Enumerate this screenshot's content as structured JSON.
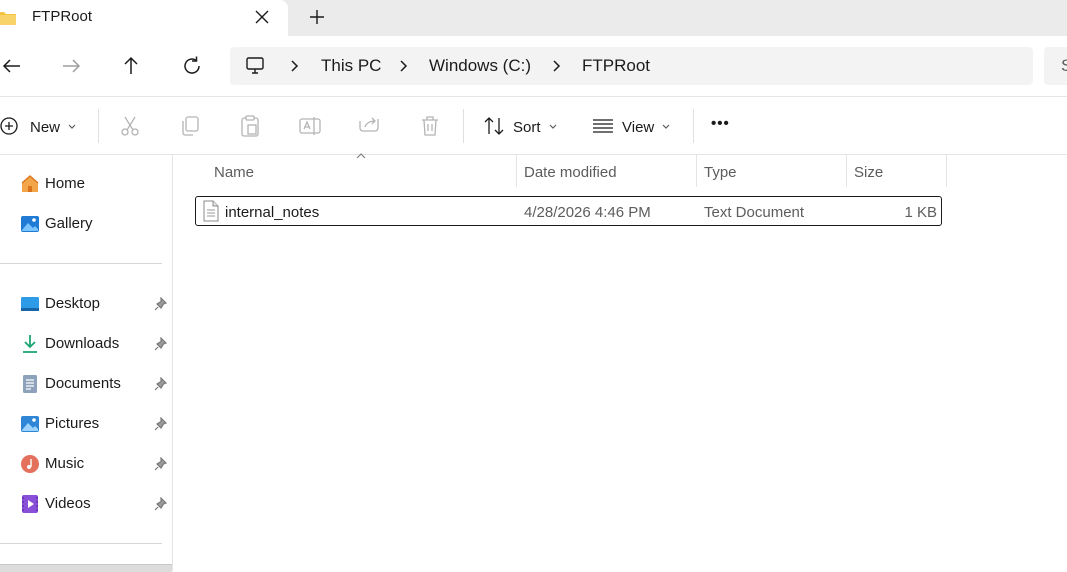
{
  "tab": {
    "title": "FTPRoot",
    "close_icon": "close-icon",
    "new_tab_icon": "plus-icon"
  },
  "nav": {
    "back": "back-arrow-icon",
    "forward": "forward-arrow-icon",
    "up": "up-arrow-icon",
    "refresh": "refresh-icon"
  },
  "breadcrumb": {
    "root_icon": "monitor-icon",
    "items": [
      "This PC",
      "Windows (C:)",
      "FTPRoot"
    ]
  },
  "search": {
    "placeholder": "S"
  },
  "toolbar": {
    "new_label": "New",
    "sort_label": "Sort",
    "view_label": "View",
    "more_label": "•••",
    "icons": [
      "cut-icon",
      "copy-icon",
      "paste-icon",
      "rename-icon",
      "share-icon",
      "delete-icon"
    ]
  },
  "sidebar": {
    "top": [
      {
        "label": "Home",
        "icon": "home-icon"
      },
      {
        "label": "Gallery",
        "icon": "gallery-icon"
      }
    ],
    "pinned": [
      {
        "label": "Desktop",
        "icon": "desktop-icon"
      },
      {
        "label": "Downloads",
        "icon": "downloads-icon"
      },
      {
        "label": "Documents",
        "icon": "documents-icon"
      },
      {
        "label": "Pictures",
        "icon": "pictures-icon"
      },
      {
        "label": "Music",
        "icon": "music-icon"
      },
      {
        "label": "Videos",
        "icon": "videos-icon"
      }
    ]
  },
  "files": {
    "columns": [
      "Name",
      "Date modified",
      "Type",
      "Size"
    ],
    "rows": [
      {
        "name": "internal_notes",
        "date": "4/28/2026 4:46 PM",
        "type": "Text Document",
        "size": "1 KB"
      }
    ]
  },
  "colors": {
    "accent": "#0067c0",
    "folder": "#f5c542",
    "selection_border": "#1b1b1b"
  }
}
